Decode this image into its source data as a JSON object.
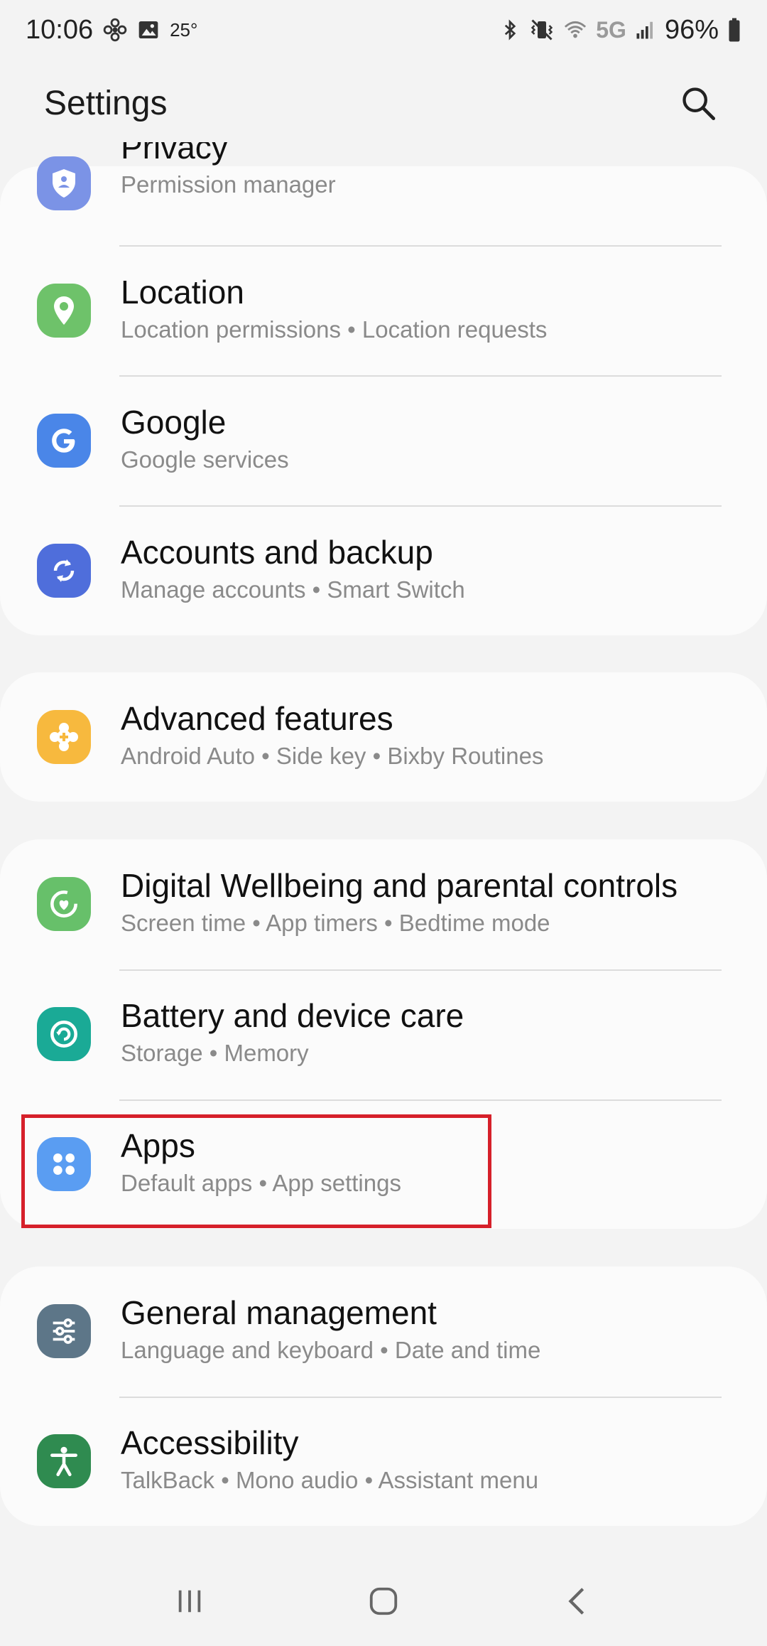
{
  "status_bar": {
    "time": "10:06",
    "temperature": "25°",
    "network": "5G",
    "battery": "96%",
    "icons": [
      "fan-icon",
      "gallery-icon",
      "bluetooth-icon",
      "vibrate-icon",
      "wifi-icon",
      "signal-icon",
      "battery-icon"
    ]
  },
  "header": {
    "title": "Settings",
    "search_icon": "search-icon"
  },
  "items": [
    {
      "id": "privacy",
      "title": "Privacy",
      "subtitle": "Permission manager",
      "icon": "privacy-shield-icon",
      "color": "#7b93e6"
    },
    {
      "id": "location",
      "title": "Location",
      "subtitle": "Location permissions  •  Location requests",
      "icon": "location-pin-icon",
      "color": "#6ec26a"
    },
    {
      "id": "google",
      "title": "Google",
      "subtitle": "Google services",
      "icon": "google-g-icon",
      "color": "#4a86e8"
    },
    {
      "id": "accounts",
      "title": "Accounts and backup",
      "subtitle": "Manage accounts  •  Smart Switch",
      "icon": "sync-icon",
      "color": "#4f6edb"
    },
    {
      "id": "advanced",
      "title": "Advanced features",
      "subtitle": "Android Auto  •  Side key  •  Bixby Routines",
      "icon": "gear-plus-icon",
      "color": "#f7b93e"
    },
    {
      "id": "wellbeing",
      "title": "Digital Wellbeing and parental controls",
      "subtitle": "Screen time  •  App timers  •  Bedtime mode",
      "icon": "wellbeing-heart-icon",
      "color": "#67c06a"
    },
    {
      "id": "battery",
      "title": "Battery and device care",
      "subtitle": "Storage  •  Memory",
      "icon": "device-care-icon",
      "color": "#1aaa96"
    },
    {
      "id": "apps",
      "title": "Apps",
      "subtitle": "Default apps  •  App settings",
      "icon": "apps-grid-icon",
      "color": "#5a9df2"
    },
    {
      "id": "general",
      "title": "General management",
      "subtitle": "Language and keyboard  •  Date and time",
      "icon": "sliders-icon",
      "color": "#5d7688"
    },
    {
      "id": "accessibility",
      "title": "Accessibility",
      "subtitle": "TalkBack  •  Mono audio  •  Assistant menu",
      "icon": "accessibility-person-icon",
      "color": "#2f8b50"
    }
  ],
  "highlight_color": "#d6202a",
  "nav_bar": {
    "recents_icon": "recents-icon",
    "home_icon": "home-icon",
    "back_icon": "back-icon"
  }
}
